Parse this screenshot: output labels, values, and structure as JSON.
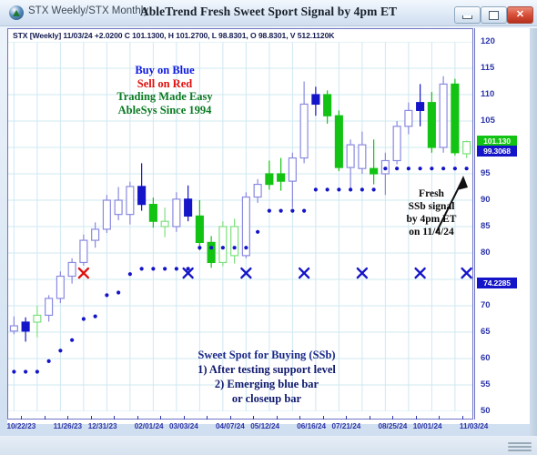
{
  "window": {
    "doc_title": "STX Weekly/STX Monthly",
    "title": "AbleTrend Fresh Sweet Sport Signal by 4pm ET",
    "app_icon": "ablesys-logo-icon",
    "buttons": {
      "minimize": "minimize-icon",
      "maximize": "maximize-icon",
      "close": "✕"
    }
  },
  "quote_line": "STX [Weekly]  11/03/24  +2.0200  C 101.1300,  H 101.2700,  L 98.8301,  O 98.8301,  V 512.1120K",
  "annotations": {
    "top": {
      "line1": "Buy on Blue",
      "line2": "Sell on Red",
      "line3": "Trading Made Easy",
      "line4": "AbleSys Since 1994",
      "colors": {
        "line1": "#0d18e0",
        "line2": "#e01010",
        "line3": "#0a7a22",
        "line4": "#0a7a22"
      }
    },
    "right": {
      "line1": "Fresh",
      "line2": "SSb signal",
      "line3": "by 4pm ET",
      "line4": "on 11/4/24"
    },
    "bottom": {
      "heading": "Sweet Spot for Buying (SSb)",
      "line1": "1) After testing support level",
      "line2": "2) Emerging blue bar",
      "line3": "or closeup bar"
    }
  },
  "chart_data": {
    "type": "candlestick",
    "title": "AbleTrend Fresh Sweet Sport Signal by 4pm ET",
    "symbol": "STX",
    "interval": "Weekly",
    "xlabel": "",
    "ylabel": "",
    "ylim": [
      50,
      120
    ],
    "y_ticks": [
      120,
      115,
      110,
      105,
      100,
      95,
      90,
      85,
      80,
      75,
      70,
      65,
      60,
      55,
      50
    ],
    "y_tick_labels": [
      "120",
      "115",
      "110",
      "105",
      "95",
      "90",
      "85",
      "80",
      "70",
      "65",
      "60",
      "55",
      "50"
    ],
    "grid": true,
    "price_badges": [
      {
        "label": "101.130",
        "value": 101.13,
        "color": "#13c313",
        "text_color": "#ffffff",
        "name": "high-price-badge"
      },
      {
        "label": "99.3068",
        "value": 99.3068,
        "color": "#1414c8",
        "text_color": "#ffffff",
        "name": "close-price-badge"
      },
      {
        "label": "74.2285",
        "value": 74.2285,
        "color": "#1414c8",
        "text_color": "#ffffff",
        "name": "stop-price-badge"
      }
    ],
    "x_tick_labels": [
      "10/22/23",
      "11/26/23",
      "12/31/23",
      "02/01/24",
      "03/03/24",
      "04/07/24",
      "05/12/24",
      "06/16/24",
      "07/21/24",
      "08/25/24",
      "10/01/24",
      "11/03/24"
    ],
    "colors": {
      "blue_bar": "#1414c8",
      "blue_hollow": "#8a8ae0",
      "green_bar": "#13c313",
      "green_hollow": "#7ee07e",
      "dot_blue": "#1414c8",
      "x_red": "#e01010",
      "x_blue": "#1414c8",
      "grid": "#cfe8f2",
      "frame": "#6e74c4",
      "axis_text": "#2c35a8"
    },
    "candles": [
      {
        "o": 66.2,
        "h": 68.0,
        "l": 64.6,
        "c": 65.2,
        "color": "blue-hollow"
      },
      {
        "o": 65.2,
        "h": 67.8,
        "l": 63.2,
        "c": 66.9,
        "color": "blue-filled"
      },
      {
        "o": 66.9,
        "h": 70.0,
        "l": 64.0,
        "c": 68.2,
        "color": "green-hollow"
      },
      {
        "o": 68.2,
        "h": 72.0,
        "l": 67.0,
        "c": 71.4,
        "color": "blue-hollow"
      },
      {
        "o": 71.4,
        "h": 76.5,
        "l": 70.5,
        "c": 75.6,
        "color": "blue-hollow"
      },
      {
        "o": 75.6,
        "h": 79.0,
        "l": 74.2,
        "c": 78.2,
        "color": "blue-hollow"
      },
      {
        "o": 78.2,
        "h": 83.5,
        "l": 77.6,
        "c": 82.4,
        "color": "blue-hollow"
      },
      {
        "o": 82.4,
        "h": 85.8,
        "l": 81.0,
        "c": 84.5,
        "color": "blue-hollow"
      },
      {
        "o": 84.5,
        "h": 91.0,
        "l": 83.8,
        "c": 90.0,
        "color": "blue-hollow"
      },
      {
        "o": 90.0,
        "h": 92.5,
        "l": 86.2,
        "c": 87.3,
        "color": "blue-hollow"
      },
      {
        "o": 87.3,
        "h": 93.5,
        "l": 85.4,
        "c": 92.6,
        "color": "blue-hollow"
      },
      {
        "o": 92.6,
        "h": 97.0,
        "l": 88.0,
        "c": 89.2,
        "color": "blue-filled"
      },
      {
        "o": 89.2,
        "h": 90.5,
        "l": 84.8,
        "c": 86.0,
        "color": "green-filled"
      },
      {
        "o": 86.0,
        "h": 88.6,
        "l": 83.0,
        "c": 85.0,
        "color": "green-hollow"
      },
      {
        "o": 85.0,
        "h": 91.5,
        "l": 84.0,
        "c": 90.2,
        "color": "blue-hollow"
      },
      {
        "o": 90.2,
        "h": 92.8,
        "l": 86.0,
        "c": 87.0,
        "color": "blue-filled"
      },
      {
        "o": 87.0,
        "h": 90.0,
        "l": 80.5,
        "c": 82.0,
        "color": "green-filled"
      },
      {
        "o": 82.0,
        "h": 83.2,
        "l": 77.2,
        "c": 78.2,
        "color": "green-filled"
      },
      {
        "o": 78.2,
        "h": 86.0,
        "l": 77.5,
        "c": 85.0,
        "color": "green-hollow"
      },
      {
        "o": 85.0,
        "h": 86.5,
        "l": 78.0,
        "c": 79.5,
        "color": "green-hollow"
      },
      {
        "o": 79.5,
        "h": 91.5,
        "l": 79.0,
        "c": 90.6,
        "color": "blue-hollow"
      },
      {
        "o": 90.6,
        "h": 94.0,
        "l": 89.5,
        "c": 93.0,
        "color": "blue-hollow"
      },
      {
        "o": 93.0,
        "h": 97.5,
        "l": 92.0,
        "c": 95.0,
        "color": "green-filled"
      },
      {
        "o": 95.0,
        "h": 98.0,
        "l": 91.8,
        "c": 93.6,
        "color": "green-filled"
      },
      {
        "o": 93.6,
        "h": 99.0,
        "l": 88.5,
        "c": 98.0,
        "color": "blue-hollow"
      },
      {
        "o": 98.0,
        "h": 112.5,
        "l": 97.0,
        "c": 108.2,
        "color": "blue-hollow"
      },
      {
        "o": 108.2,
        "h": 111.5,
        "l": 106.0,
        "c": 110.0,
        "color": "blue-filled"
      },
      {
        "o": 110.0,
        "h": 110.8,
        "l": 104.5,
        "c": 106.0,
        "color": "green-filled"
      },
      {
        "o": 106.0,
        "h": 107.0,
        "l": 95.5,
        "c": 96.2,
        "color": "green-filled"
      },
      {
        "o": 96.2,
        "h": 101.5,
        "l": 92.0,
        "c": 100.5,
        "color": "blue-hollow"
      },
      {
        "o": 100.5,
        "h": 103.0,
        "l": 95.0,
        "c": 96.0,
        "color": "blue-hollow"
      },
      {
        "o": 96.0,
        "h": 101.5,
        "l": 93.0,
        "c": 95.0,
        "color": "green-filled"
      },
      {
        "o": 95.0,
        "h": 99.0,
        "l": 91.0,
        "c": 97.5,
        "color": "blue-hollow"
      },
      {
        "o": 97.5,
        "h": 105.0,
        "l": 96.8,
        "c": 104.0,
        "color": "blue-hollow"
      },
      {
        "o": 104.0,
        "h": 108.5,
        "l": 102.5,
        "c": 107.0,
        "color": "blue-hollow"
      },
      {
        "o": 107.0,
        "h": 112.0,
        "l": 104.0,
        "c": 108.5,
        "color": "blue-filled"
      },
      {
        "o": 108.5,
        "h": 110.5,
        "l": 99.0,
        "c": 100.0,
        "color": "green-filled"
      },
      {
        "o": 100.0,
        "h": 113.5,
        "l": 99.0,
        "c": 112.0,
        "color": "blue-hollow"
      },
      {
        "o": 112.0,
        "h": 113.0,
        "l": 98.5,
        "c": 99.0,
        "color": "green-filled"
      },
      {
        "o": 98.8,
        "h": 101.3,
        "l": 98.0,
        "c": 101.1,
        "color": "green-hollow"
      }
    ]
  }
}
